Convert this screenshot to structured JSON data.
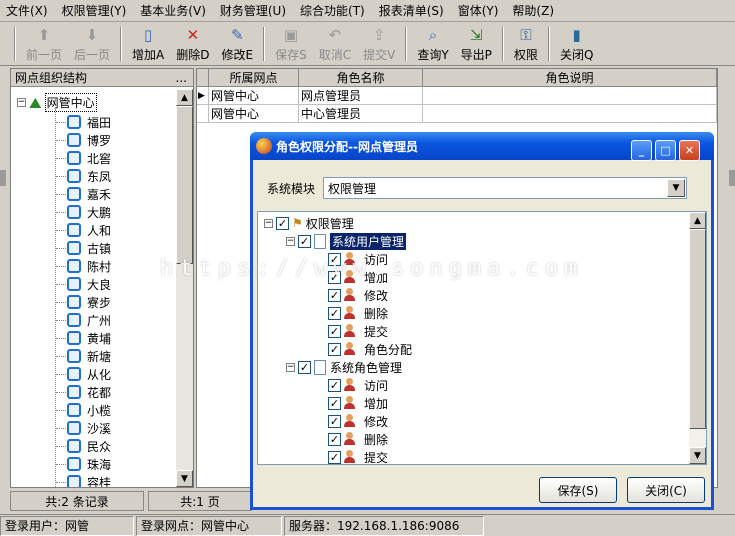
{
  "menu": [
    "文件(X)",
    "权限管理(Y)",
    "基本业务(V)",
    "财务管理(U)",
    "综合功能(T)",
    "报表清单(S)",
    "窗体(Y)",
    "帮助(Z)"
  ],
  "toolbar": [
    {
      "label": "前一页",
      "icon": "arrow-up-icon",
      "enabled": false
    },
    {
      "label": "后一页",
      "icon": "arrow-down-icon",
      "enabled": false
    },
    {
      "label": "增加A",
      "icon": "new-document-icon",
      "enabled": true
    },
    {
      "label": "删除D",
      "icon": "delete-x-icon",
      "enabled": true
    },
    {
      "label": "修改E",
      "icon": "edit-icon",
      "enabled": true
    },
    {
      "label": "保存S",
      "icon": "save-icon",
      "enabled": false
    },
    {
      "label": "取消C",
      "icon": "undo-icon",
      "enabled": false
    },
    {
      "label": "提交V",
      "icon": "submit-icon",
      "enabled": false
    },
    {
      "label": "查询Y",
      "icon": "query-icon",
      "enabled": true
    },
    {
      "label": "导出P",
      "icon": "export-icon",
      "enabled": true
    },
    {
      "label": "权限",
      "icon": "permission-icon",
      "enabled": true
    },
    {
      "label": "关闭Q",
      "icon": "close-book-icon",
      "enabled": true
    }
  ],
  "left_panel": {
    "title": "网点组织结构",
    "more": "...",
    "root": "网管中心",
    "nodes": [
      "福田",
      "博罗",
      "北窖",
      "东凤",
      "嘉禾",
      "大鹏",
      "人和",
      "古镇",
      "陈村",
      "大良",
      "寮步",
      "广州",
      "黄埔",
      "新塘",
      "从化",
      "花都",
      "小榄",
      "沙溪",
      "民众",
      "珠海",
      "容桂"
    ]
  },
  "grid": {
    "columns": [
      "所属网点",
      "角色名称",
      "角色说明"
    ],
    "rows": [
      [
        "网管中心",
        "网点管理员",
        ""
      ],
      [
        "网管中心",
        "中心管理员",
        ""
      ]
    ]
  },
  "counts": {
    "records": "共:2 条记录",
    "pages": "共:1 页"
  },
  "status": {
    "user": "登录用户：网管",
    "site": "登录网点：网管中心",
    "server": "服务器：192.168.1.186:9086"
  },
  "dialog": {
    "title": "角色权限分配--网点管理员",
    "module_label": "系统模块",
    "module_value": "权限管理",
    "tree": {
      "root": "权限管理",
      "groups": [
        {
          "label": "系统用户管理",
          "items": [
            "访问",
            "增加",
            "修改",
            "删除",
            "提交",
            "角色分配"
          ]
        },
        {
          "label": "系统角色管理",
          "items": [
            "访问",
            "增加",
            "修改",
            "删除",
            "提交"
          ]
        }
      ]
    },
    "save_label": "保存(S)",
    "close_label": "关闭(C)"
  },
  "watermark": "https://www.songma.com"
}
